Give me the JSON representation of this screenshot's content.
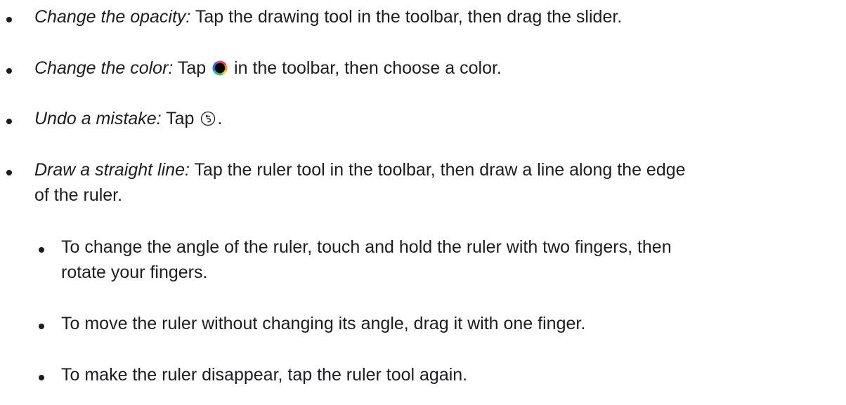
{
  "items": [
    {
      "lead": "Change the opacity:",
      "text": " Tap the drawing tool in the toolbar, then drag the slider."
    },
    {
      "lead": "Change the color:",
      "text_before": " Tap ",
      "icon": "color-wheel-icon",
      "text_after": " in the toolbar, then choose a color."
    },
    {
      "lead": "Undo a mistake:",
      "text_before": " Tap ",
      "icon": "undo-icon",
      "text_after": "."
    },
    {
      "lead": "Draw a straight line:",
      "text_line1": " Tap the ruler tool in the toolbar, then draw a line along the edge",
      "text_line2": "of the ruler."
    }
  ],
  "subitems": [
    {
      "line1": "To change the angle of the ruler, touch and hold the ruler with two fingers, then",
      "line2": "rotate your fingers."
    },
    {
      "line1": "To move the ruler without changing its angle, drag it with one finger."
    },
    {
      "line1": "To make the ruler disappear, tap the ruler tool again."
    }
  ]
}
